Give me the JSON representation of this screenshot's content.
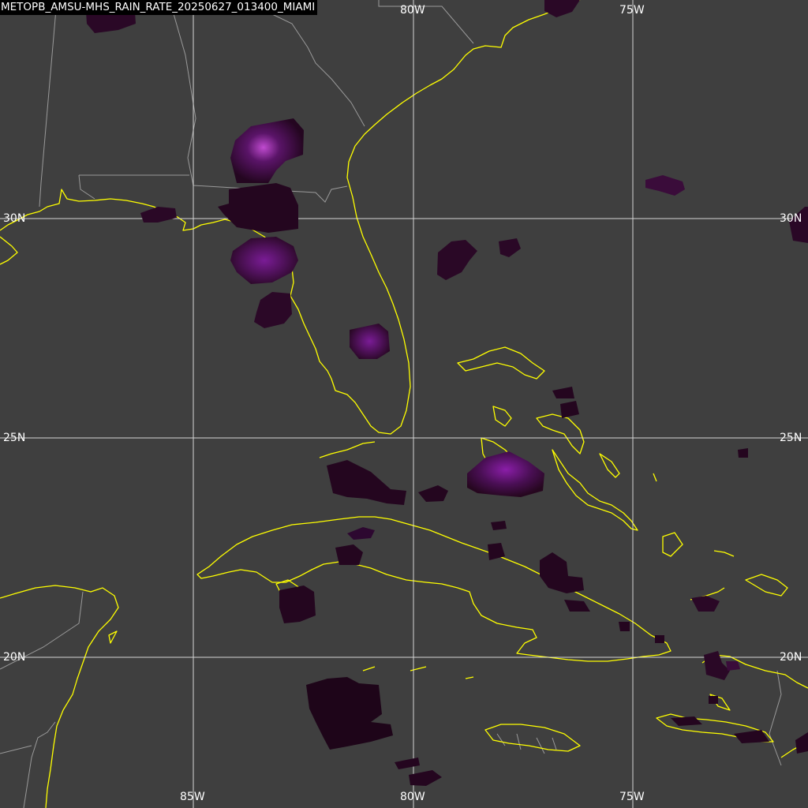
{
  "title": "METOPB_AMSU-MHS_RAIN_RATE_20250627_013400_MIAMI",
  "grid": {
    "longitudes": [
      {
        "label": "85W"
      },
      {
        "label": "80W"
      },
      {
        "label": "75W"
      }
    ],
    "latitudes": [
      {
        "label": "30N"
      },
      {
        "label": "25N"
      },
      {
        "label": "20N"
      }
    ]
  },
  "colors": {
    "background": "#3f3f3f",
    "coastline": "#ffff00",
    "borders": "#9a9a9a",
    "graticule": "#e6e6e6",
    "rain_low": "#24061f",
    "rain_mid": "#4a0f55",
    "rain_high": "#8a1ea8"
  }
}
